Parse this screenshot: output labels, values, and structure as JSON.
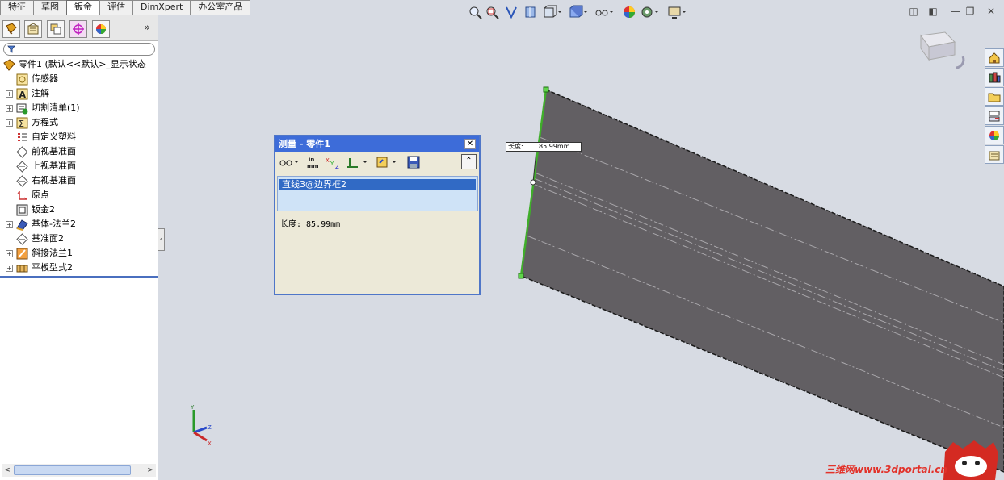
{
  "tabs": [
    "特征",
    "草图",
    "钣金",
    "评估",
    "DimXpert",
    "办公室产品"
  ],
  "active_tab": "钣金",
  "panel": {
    "more_label": "»",
    "tree": [
      {
        "label": "零件1   (默认<<默认>_显示状态",
        "icon": "part-icon",
        "expand": false
      },
      {
        "label": "传感器",
        "icon": "sensor-icon",
        "expand": false
      },
      {
        "label": "注解",
        "icon": "annotation-icon",
        "expand": true
      },
      {
        "label": "切割清单(1)",
        "icon": "cutlist-icon",
        "expand": true
      },
      {
        "label": "方程式",
        "icon": "equation-icon",
        "expand": true
      },
      {
        "label": "自定义塑料",
        "icon": "material-icon",
        "expand": false
      },
      {
        "label": "前视基准面",
        "icon": "plane-icon",
        "expand": false
      },
      {
        "label": "上视基准面",
        "icon": "plane-icon",
        "expand": false
      },
      {
        "label": "右视基准面",
        "icon": "plane-icon",
        "expand": false
      },
      {
        "label": "原点",
        "icon": "origin-icon",
        "expand": false
      },
      {
        "label": "钣金2",
        "icon": "sheetmetal-icon",
        "expand": false
      },
      {
        "label": "基体-法兰2",
        "icon": "baseflange-icon",
        "expand": true
      },
      {
        "label": "基准面2",
        "icon": "plane-icon",
        "expand": false
      },
      {
        "label": "斜接法兰1",
        "icon": "miterflange-icon",
        "expand": true
      },
      {
        "label": "平板型式2",
        "icon": "flatpattern-icon",
        "expand": true
      }
    ],
    "scroll_left": "<",
    "scroll_right": ">"
  },
  "splitter_label": "‹",
  "dialog": {
    "title": "测量 - 零件1",
    "close": "✕",
    "collapse": "⌃",
    "selection": "直线3@边界框2",
    "result": "长度: 85.99mm"
  },
  "callout": {
    "label": "长度:",
    "value": "85.99mm"
  },
  "window_buttons": [
    "◫",
    "◧",
    "—",
    "❐",
    "✕"
  ],
  "triad": {
    "y": "Y",
    "z": "Z",
    "x": "X"
  },
  "watermark": "三维网www.3dportal.cn",
  "colors": {
    "face": "#625f63",
    "edge_green": "#3fae2a",
    "title_blue": "#3d6cd9",
    "selection_blue": "#316ac5"
  }
}
